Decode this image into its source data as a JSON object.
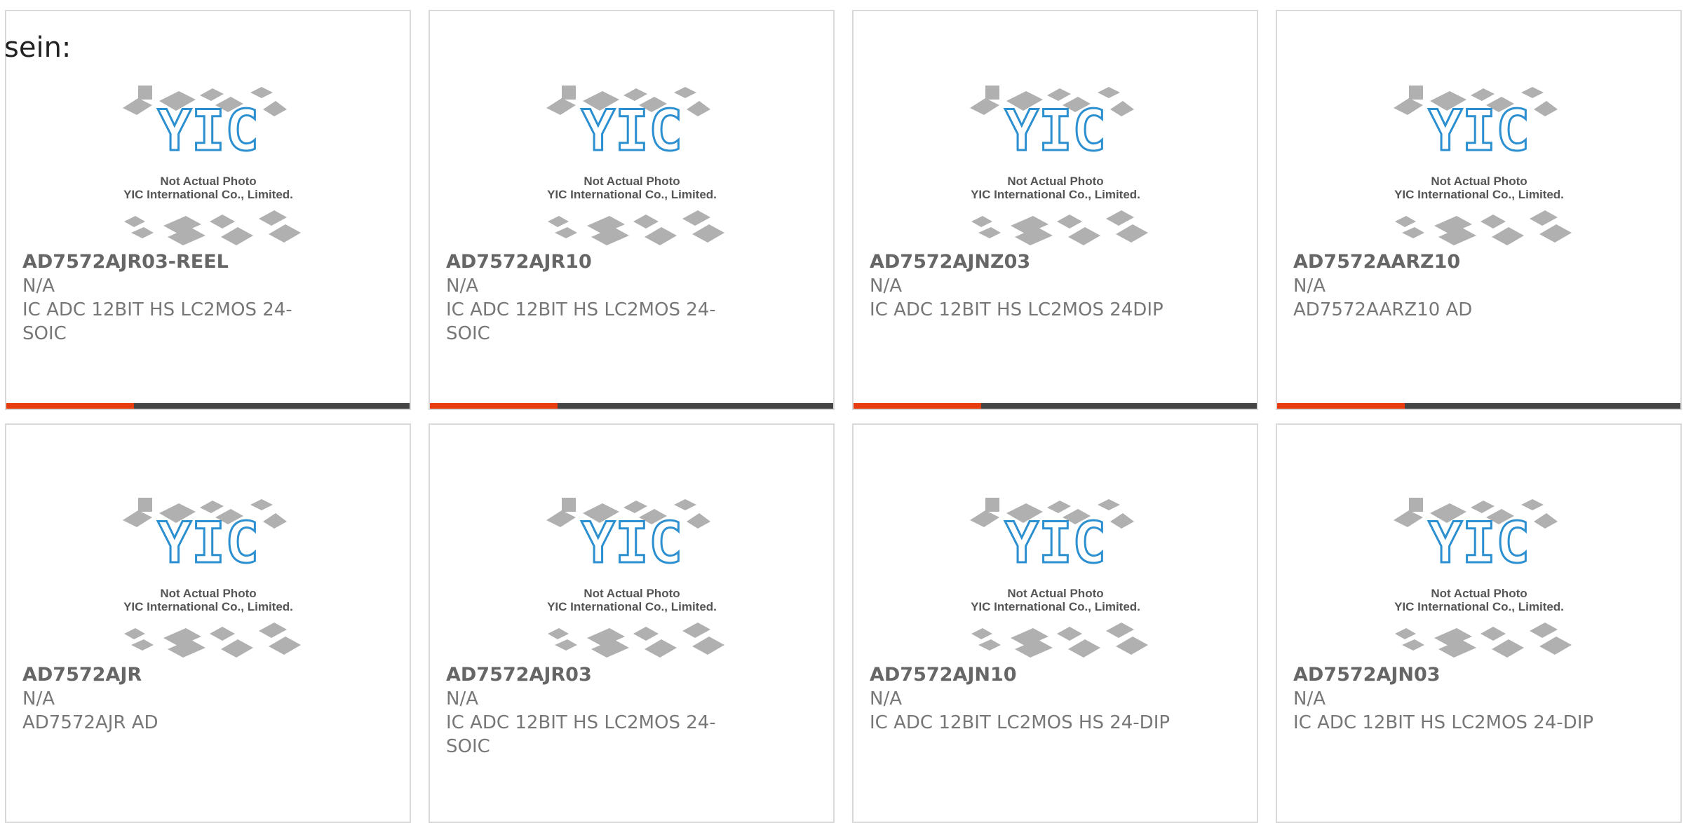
{
  "page": {
    "heading": "sein:"
  },
  "placeholder": {
    "line1": "Not Actual Photo",
    "line2": "YIC International Co., Limited.",
    "logo": "YIC"
  },
  "colors": {
    "accent": "#e63c0f",
    "bar": "#444444",
    "logo": "#2b8fd0"
  },
  "cards": [
    {
      "part": "AD7572AJR03-REEL",
      "mfr": "N/A",
      "desc": "IC ADC 12BIT HS LC2MOS 24-SOIC"
    },
    {
      "part": "AD7572AJR10",
      "mfr": "N/A",
      "desc": "IC ADC 12BIT HS LC2MOS 24-SOIC"
    },
    {
      "part": "AD7572AJNZ03",
      "mfr": "N/A",
      "desc": "IC ADC 12BIT HS LC2MOS 24DIP"
    },
    {
      "part": "AD7572AARZ10",
      "mfr": "N/A",
      "desc": "AD7572AARZ10 AD"
    },
    {
      "part": "AD7572AJR",
      "mfr": "N/A",
      "desc": "AD7572AJR AD"
    },
    {
      "part": "AD7572AJR03",
      "mfr": "N/A",
      "desc": "IC ADC 12BIT HS LC2MOS 24-SOIC"
    },
    {
      "part": "AD7572AJN10",
      "mfr": "N/A",
      "desc": "IC ADC 12BIT LC2MOS HS 24-DIP"
    },
    {
      "part": "AD7572AJN03",
      "mfr": "N/A",
      "desc": "IC ADC 12BIT HS LC2MOS 24-DIP"
    }
  ]
}
